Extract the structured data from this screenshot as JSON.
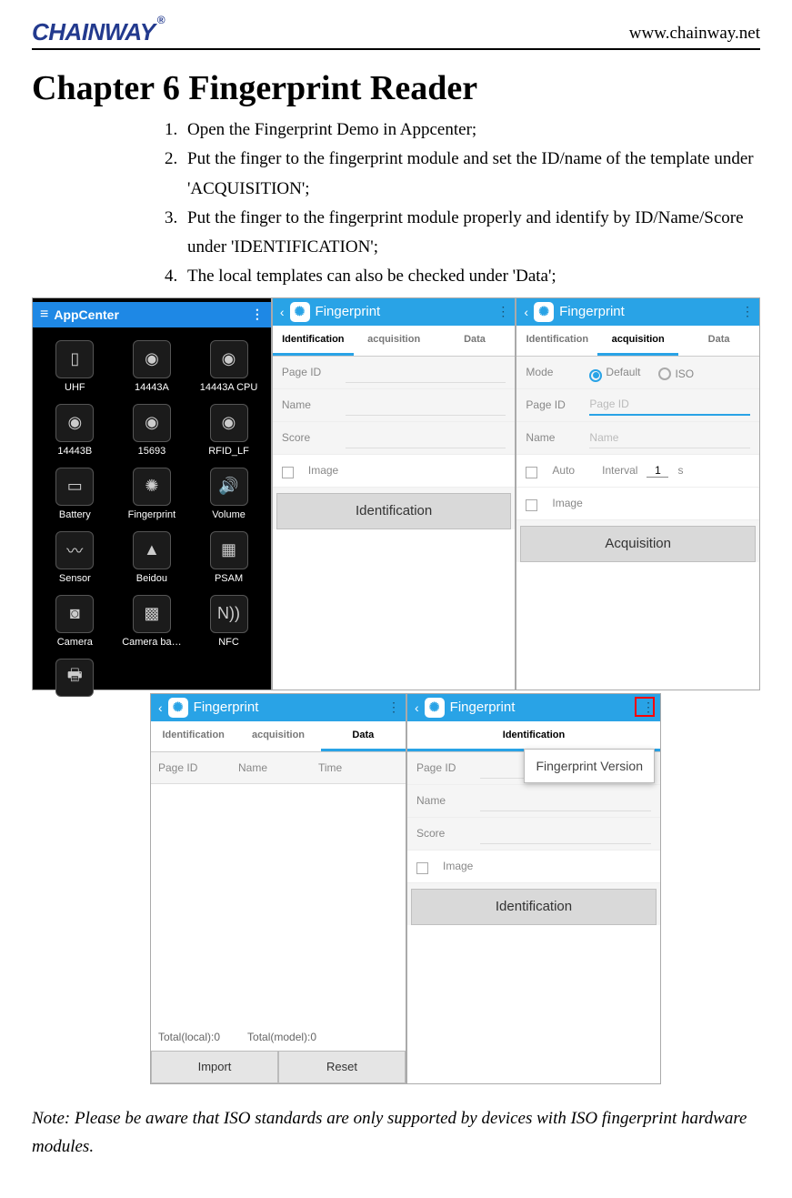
{
  "header": {
    "logo": "CHAINWAY",
    "logo_reg": "®",
    "url": "www.chainway.net"
  },
  "chapter": {
    "title": "Chapter 6 Fingerprint Reader"
  },
  "steps": [
    "Open the Fingerprint Demo in Appcenter;",
    "Put the finger to the fingerprint module and set the ID/name of the template under 'ACQUISITION';",
    "Put the finger to the fingerprint module properly and identify by ID/Name/Score under 'IDENTIFICATION';",
    "The local templates can also be checked under 'Data';"
  ],
  "appcenter": {
    "title": "AppCenter",
    "apps": [
      {
        "label": "UHF",
        "glyph": "▯"
      },
      {
        "label": "14443A",
        "glyph": "◉"
      },
      {
        "label": "14443A CPU",
        "glyph": "◉"
      },
      {
        "label": "14443B",
        "glyph": "◉"
      },
      {
        "label": "15693",
        "glyph": "◉"
      },
      {
        "label": "RFID_LF",
        "glyph": "◉"
      },
      {
        "label": "Battery",
        "glyph": "▭"
      },
      {
        "label": "Fingerprint",
        "glyph": "✺"
      },
      {
        "label": "Volume",
        "glyph": "🔊"
      },
      {
        "label": "Sensor",
        "glyph": "〰"
      },
      {
        "label": "Beidou",
        "glyph": "▲"
      },
      {
        "label": "PSAM",
        "glyph": "▦"
      },
      {
        "label": "Camera",
        "glyph": "◙"
      },
      {
        "label": "Camera ba…",
        "glyph": "▩"
      },
      {
        "label": "NFC",
        "glyph": "N))"
      },
      {
        "label": "Printer",
        "glyph": "🖶"
      }
    ]
  },
  "fp_title": "Fingerprint",
  "tabs": {
    "identification": "Identification",
    "acquisition": "acquisition",
    "data": "Data"
  },
  "ident": {
    "page_id": "Page ID",
    "name": "Name",
    "score": "Score",
    "image": "Image",
    "button": "Identification"
  },
  "acq": {
    "mode": "Mode",
    "default": "Default",
    "iso": "ISO",
    "page_id_lbl": "Page ID",
    "page_id_ph": "Page ID",
    "name_lbl": "Name",
    "name_ph": "Name",
    "auto": "Auto",
    "interval": "Interval",
    "interval_val": "1",
    "interval_unit": "s",
    "image": "Image",
    "button": "Acquisition"
  },
  "data_tab": {
    "col_page_id": "Page ID",
    "col_name": "Name",
    "col_time": "Time",
    "total_local": "Total(local):0",
    "total_model": "Total(model):0",
    "import": "Import",
    "reset": "Reset"
  },
  "menu_popup": "Fingerprint Version",
  "note": "Note: Please be aware that ISO standards are only supported by devices with ISO fingerprint hardware modules."
}
